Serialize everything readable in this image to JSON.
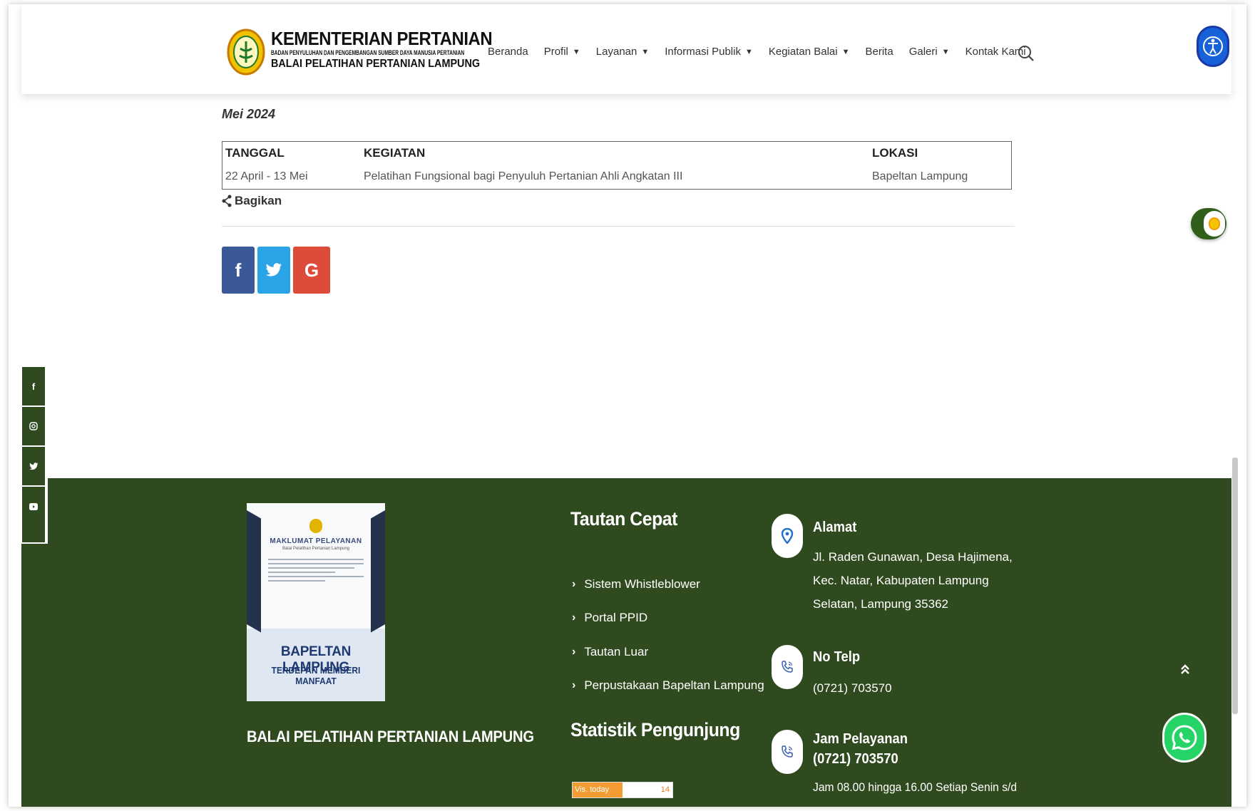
{
  "header": {
    "logo": {
      "line1": "KEMENTERIAN PERTANIAN",
      "line2": "BADAN PENYULUHAN DAN PENGEMBANGAN SUMBER DAYA MANUSIA PERTANIAN",
      "line3": "BALAI PELATIHAN PERTANIAN LAMPUNG"
    },
    "nav": [
      {
        "label": "Beranda",
        "dropdown": false
      },
      {
        "label": "Profil",
        "dropdown": true
      },
      {
        "label": "Layanan",
        "dropdown": true
      },
      {
        "label": "Informasi Publik",
        "dropdown": true
      },
      {
        "label": "Kegiatan Balai",
        "dropdown": true
      },
      {
        "label": "Berita",
        "dropdown": false
      },
      {
        "label": "Galeri",
        "dropdown": true
      },
      {
        "label": "Kontak Kami",
        "dropdown": false
      }
    ],
    "caret": "▼"
  },
  "content": {
    "month": "Mei 2024",
    "table": {
      "headers": [
        "TANGGAL",
        "KEGIATAN",
        "LOKASI"
      ],
      "rows": [
        [
          "22 April - 13 Mei",
          "Pelatihan Fungsional bagi Penyuluh Pertanian Ahli Angkatan III",
          "Bapeltan Lampung"
        ]
      ]
    },
    "share_label": "Bagikan",
    "share_buttons": [
      "f",
      "t",
      "G"
    ]
  },
  "footer": {
    "poster": {
      "title": "MAKLUMAT PELAYANAN",
      "subtitle": "Balai Pelatihan Pertanian Lampung",
      "big": "BAPELTAN LAMPUNG",
      "tagline": "TERDEPAN MEMBERI MANFAAT"
    },
    "org_name": "BALAI PELATIHAN PERTANIAN LAMPUNG",
    "quick_links_title": "Tautan Cepat",
    "quick_links": [
      "Sistem Whistleblower",
      "Portal PPID",
      "Tautan Luar",
      "Perpustakaan Bapeltan Lampung"
    ],
    "stats_title": "Statistik Pengunjung",
    "stats": {
      "label": "Vis. today",
      "value": "14"
    },
    "contacts": {
      "address_title": "Alamat",
      "address": "Jl. Raden Gunawan, Desa Hajimena, Kec. Natar, Kabupaten Lampung Selatan, Lampung 35362",
      "phone_title": "No Telp",
      "phone": "(0721) 703570",
      "hours_title": "Jam Pelayanan",
      "hours_phone": "(0721) 703570",
      "hours_text": "Jam 08.00 hingga 16.00 Setiap Senin s/d"
    }
  },
  "colors": {
    "footer_bg": "#2f4a1f",
    "accessibility": "#1762d8",
    "facebook": "#3b5998",
    "twitter": "#2aa4e7",
    "google": "#dd4b39",
    "whatsapp": "#25d366"
  },
  "icons": {
    "social_strip": [
      "facebook-icon",
      "instagram-icon",
      "twitter-icon",
      "youtube-icon"
    ]
  }
}
